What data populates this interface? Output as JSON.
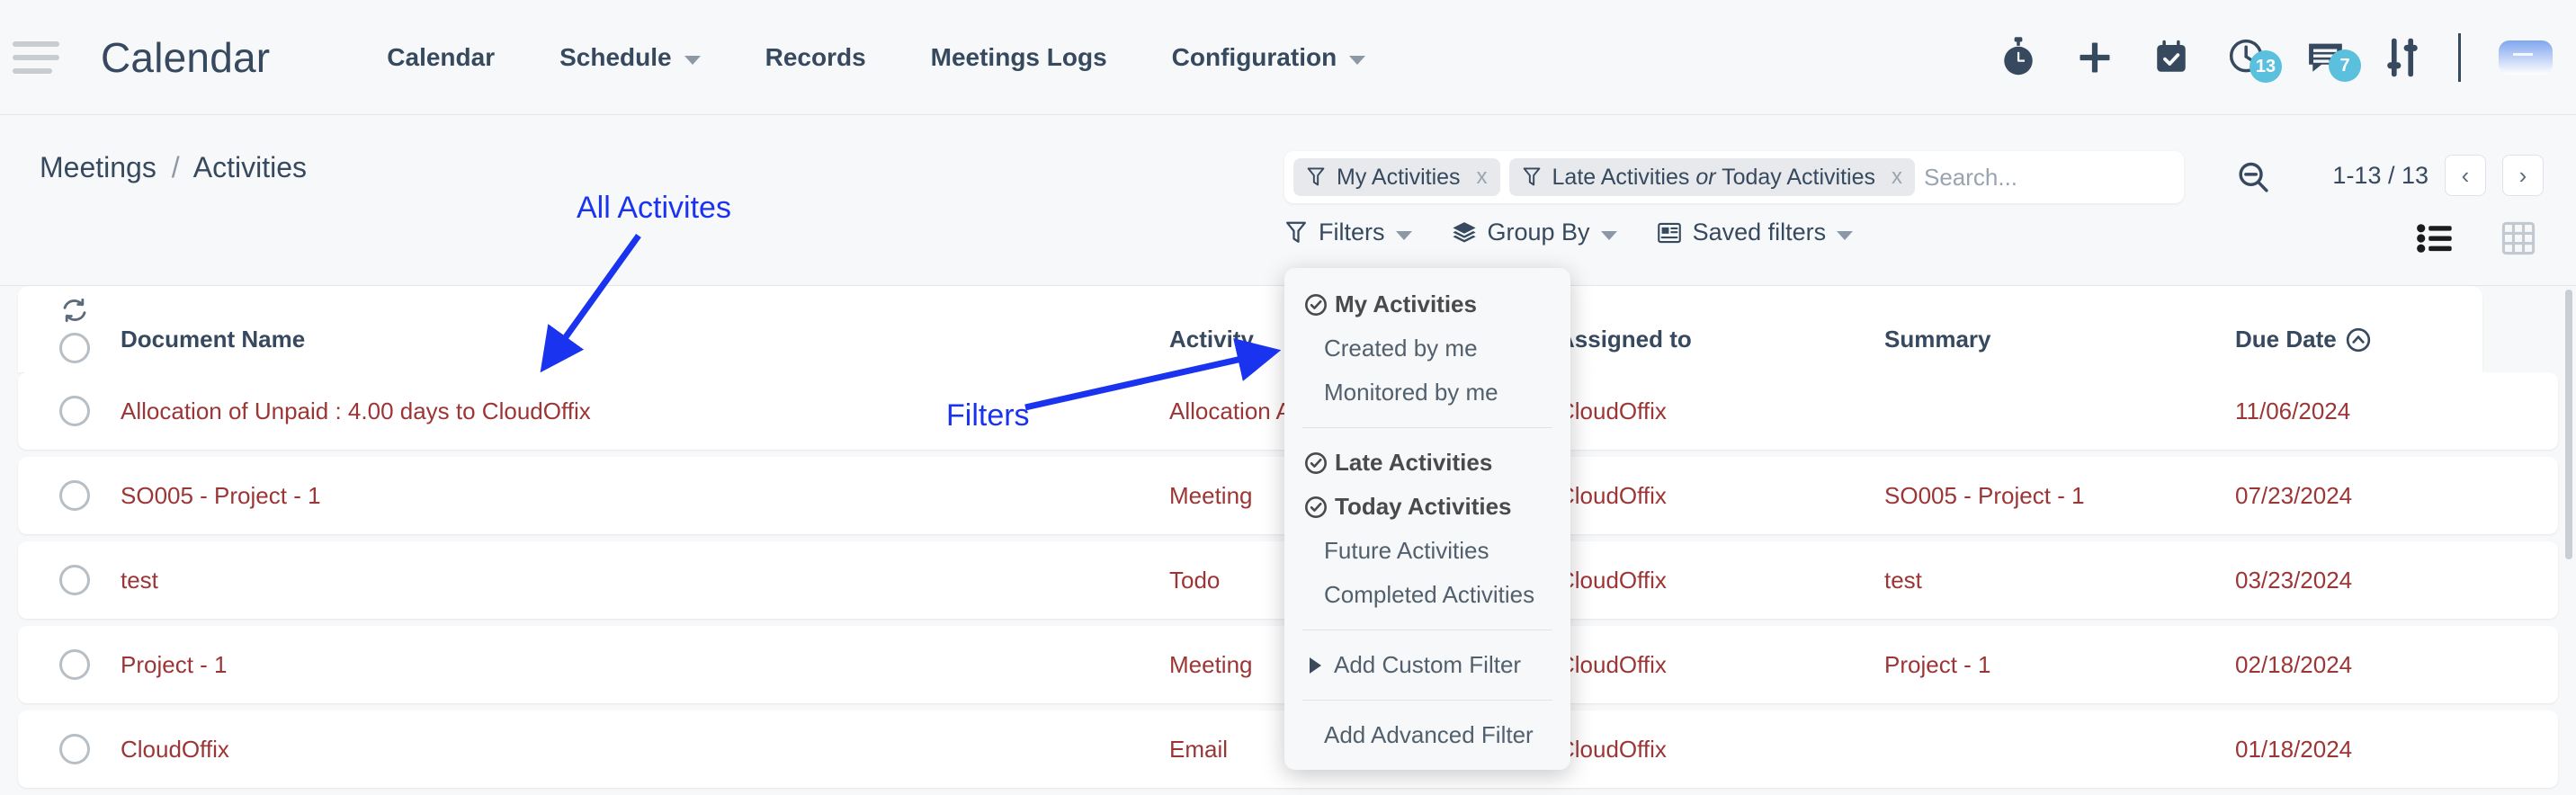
{
  "app": {
    "brand": "Calendar",
    "menu_icon": "hamburger-icon"
  },
  "nav": {
    "items": [
      {
        "label": "Calendar",
        "has_caret": false
      },
      {
        "label": "Schedule",
        "has_caret": true
      },
      {
        "label": "Records",
        "has_caret": false
      },
      {
        "label": "Meetings Logs",
        "has_caret": false
      },
      {
        "label": "Configuration",
        "has_caret": true
      }
    ],
    "right_icons": [
      {
        "name": "stopwatch-icon",
        "badge": ""
      },
      {
        "name": "plus-icon",
        "badge": ""
      },
      {
        "name": "calendar-check-icon",
        "badge": ""
      },
      {
        "name": "clock-icon",
        "badge": "13"
      },
      {
        "name": "chat-icon",
        "badge": "7"
      },
      {
        "name": "sliders-icon",
        "badge": ""
      }
    ],
    "badge_color": "#5bc0de",
    "avatar_name": "user-avatar"
  },
  "breadcrumb": {
    "parent": "Meetings",
    "separator": "/",
    "current": "Activities"
  },
  "search": {
    "placeholder": "Search...",
    "value": "",
    "chips": [
      {
        "label": "My Activities",
        "icon": "filter-icon",
        "remove": "x"
      },
      {
        "label_pre": "Late Activities ",
        "label_em": "or",
        "label_post": " Today Activities",
        "icon": "filter-icon",
        "remove": "x"
      }
    ],
    "zoom_out_icon": "magnifier-minus-icon"
  },
  "pagination": {
    "range": "1-13 / 13",
    "prev": "‹",
    "next": "›"
  },
  "toolbar": {
    "filters_label": "Filters",
    "group_by_label": "Group By",
    "saved_filters_label": "Saved filters",
    "view_list": "list-view-icon",
    "view_grid": "grid-view-icon"
  },
  "filters_dropdown": {
    "groups": [
      {
        "head": "My Activities",
        "items": [
          "Created by me",
          "Monitored by me"
        ]
      },
      {
        "head2": [
          "Late Activities",
          "Today Activities"
        ],
        "items": [
          "Future Activities",
          "Completed Activities"
        ]
      }
    ],
    "add_custom_filter": "Add Custom Filter",
    "add_advanced_filter": "Add Advanced Filter"
  },
  "table": {
    "columns": [
      {
        "label": "Document Name",
        "sort": ""
      },
      {
        "label": "Activity",
        "sort": ""
      },
      {
        "label": "Assigned to",
        "sort": ""
      },
      {
        "label": "Summary",
        "sort": ""
      },
      {
        "label": "Due Date",
        "sort": "asc"
      }
    ],
    "rows": [
      {
        "document_name": "Allocation of Unpaid : 4.00 days to CloudOffix",
        "activity": "Allocation Approval",
        "assigned_to": "CloudOffix",
        "summary": "",
        "due_date": "11/06/2024"
      },
      {
        "document_name": "SO005 - Project - 1",
        "activity": "Meeting",
        "assigned_to": "CloudOffix",
        "summary": "SO005 - Project - 1",
        "due_date": "07/23/2024"
      },
      {
        "document_name": "test",
        "activity": "Todo",
        "assigned_to": "CloudOffix",
        "summary": "test",
        "due_date": "03/23/2024"
      },
      {
        "document_name": "Project - 1",
        "activity": "Meeting",
        "assigned_to": "CloudOffix",
        "summary": "Project - 1",
        "due_date": "02/18/2024"
      },
      {
        "document_name": "CloudOffix",
        "activity": "Email",
        "assigned_to": "CloudOffix",
        "summary": "",
        "due_date": "01/18/2024"
      }
    ],
    "row_text_color": "#9c3535",
    "header_text_color": "#36495e"
  },
  "annotations": [
    {
      "text": "All Activites",
      "color": "#1a33ee"
    },
    {
      "text": "Filters",
      "color": "#1a33ee"
    }
  ]
}
